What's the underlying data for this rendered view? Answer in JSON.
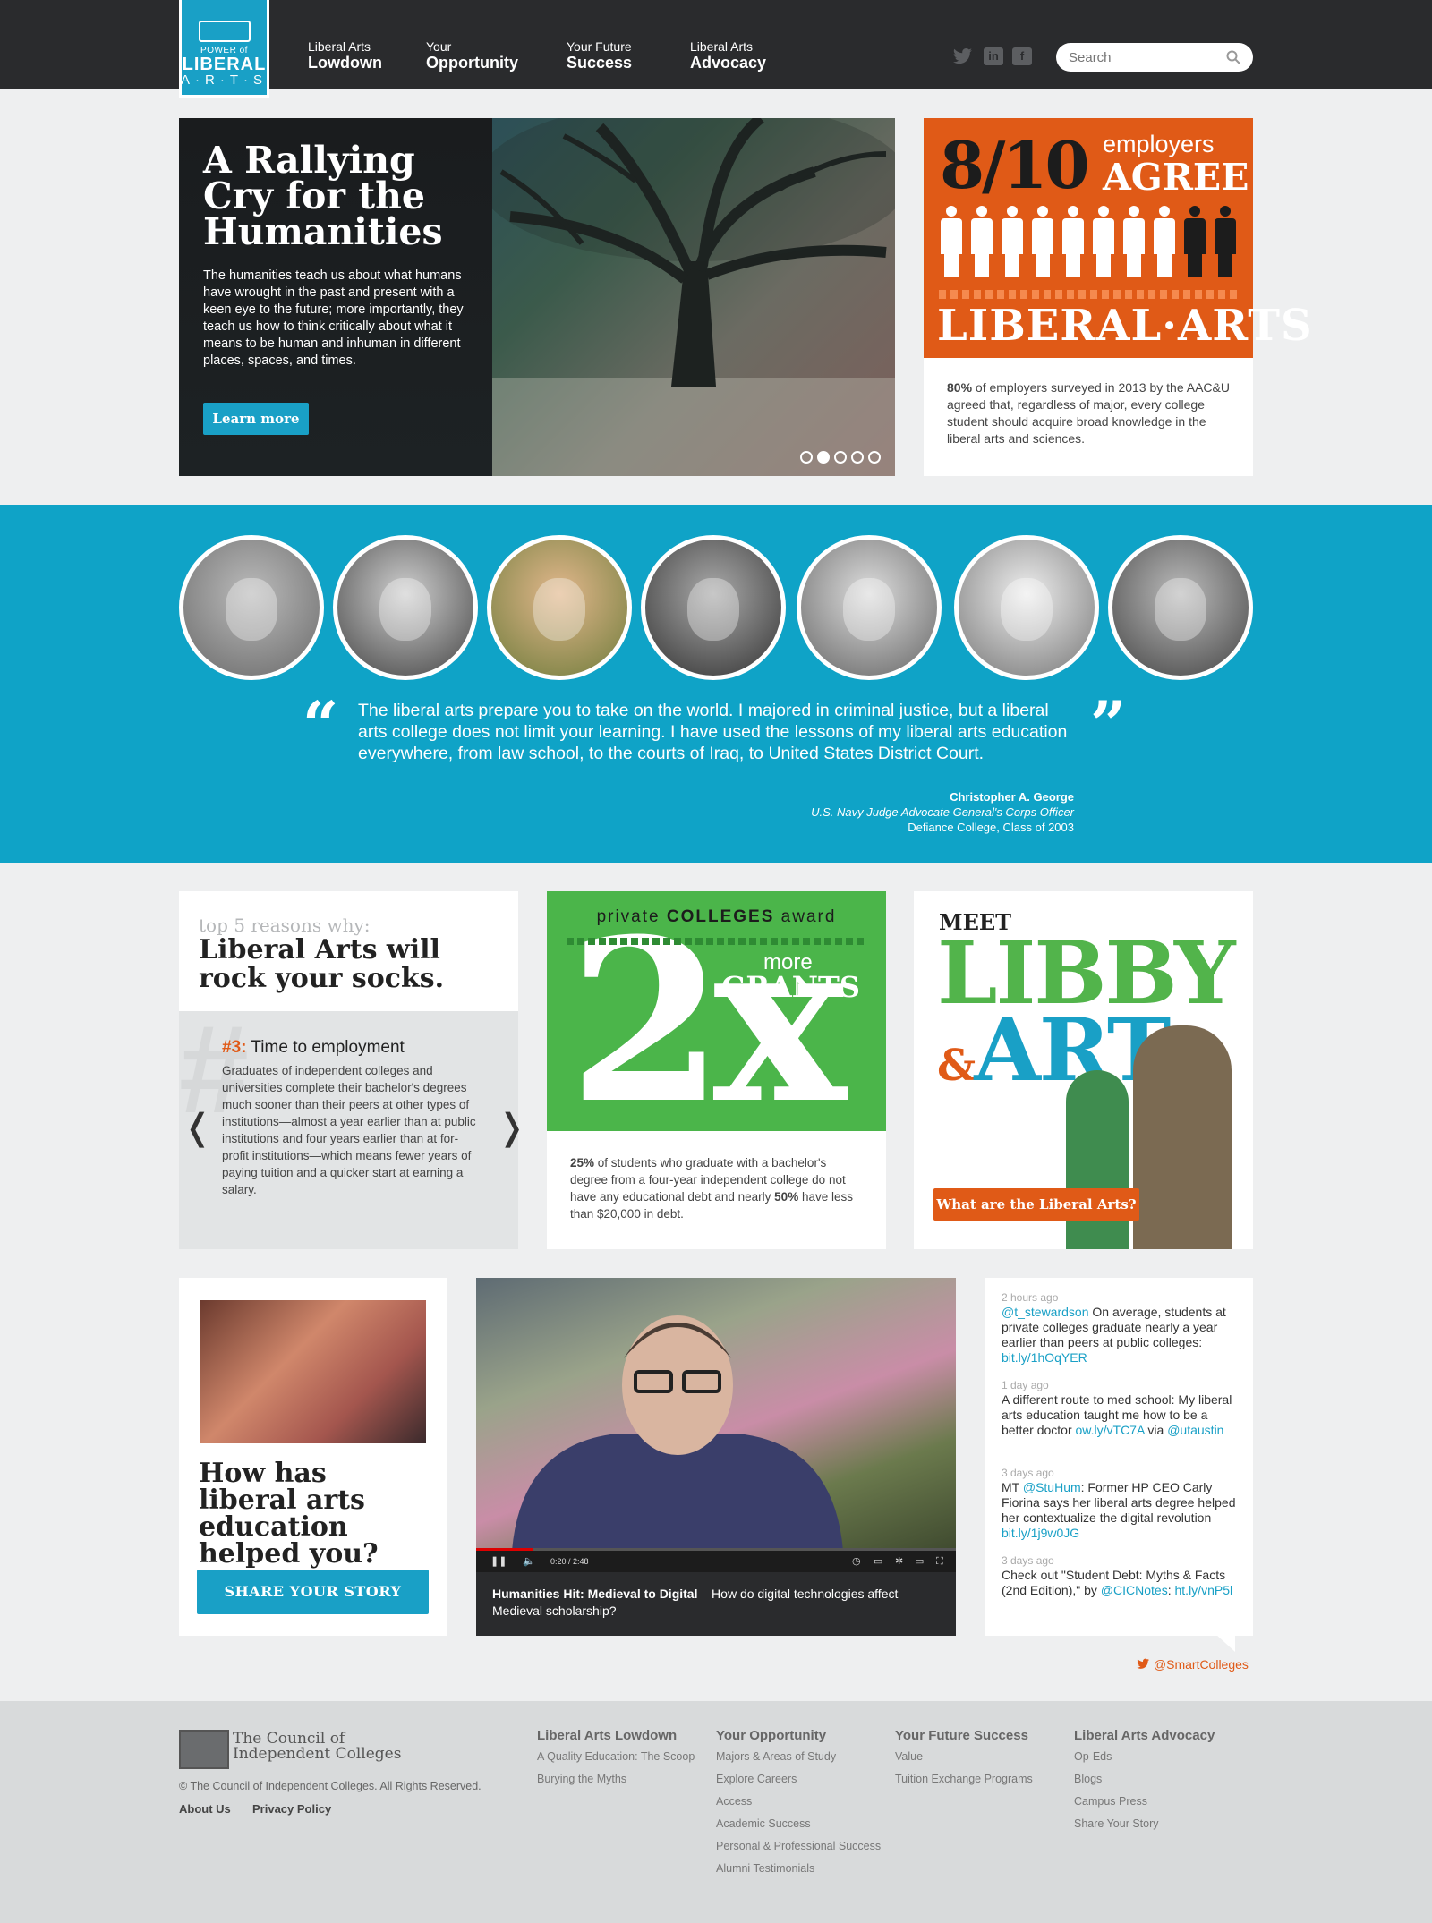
{
  "header": {
    "logo": {
      "line1": "POWER of",
      "line2": "LIBERAL",
      "line3": "A·R·T·S"
    },
    "nav": [
      {
        "small": "Liberal Arts",
        "big": "Lowdown"
      },
      {
        "small": "Your",
        "big": "Opportunity"
      },
      {
        "small": "Your Future",
        "big": "Success"
      },
      {
        "small": "Liberal Arts",
        "big": "Advocacy"
      }
    ],
    "social": [
      "twitter-icon",
      "linkedin-icon",
      "facebook-icon"
    ],
    "search_placeholder": "Search"
  },
  "hero": {
    "title": "A Rallying Cry for the Humanities",
    "body": "The humanities teach us about what humans have wrought in the past and present with a keen eye to the future; more importantly, they teach us how to think critically about what it means to be human and inhuman in different places, spaces, and times.",
    "button": "Learn more",
    "slides_total": 5,
    "slide_active": 2
  },
  "employers": {
    "big": "8/10",
    "small1": "employers",
    "small2": "AGREE",
    "banner": "LIBERAL·ARTS",
    "stat": "80%",
    "text": " of employers surveyed in 2013 by the AAC&U agreed that, regardless of major, every college student should acquire broad knowledge in the liberal arts and sciences."
  },
  "testimonial": {
    "quote": "The liberal arts prepare you to take on the world. I majored in criminal justice, but a liberal arts college does not limit your learning. I have used the lessons of my liberal arts education everywhere, from law school, to the courts of Iraq, to United States District Court.",
    "name": "Christopher A. George",
    "role": "U.S. Navy Judge Advocate General's Corps Officer",
    "school": "Defiance College, Class of 2003",
    "open_mark": "“",
    "close_mark": "”"
  },
  "reasons": {
    "kicker": "top 5 reasons why:",
    "title": "Liberal Arts will rock your socks.",
    "hash": "#",
    "number": "#3:",
    "heading": " Time to employment",
    "body": "Graduates of independent colleges and universities complete their bachelor's degrees much sooner than their peers at other types of institutions—almost a year earlier than at public institutions and four years earlier than at for-profit institutions—which means fewer years of paying tuition and a quicker start at earning a salary.",
    "prev": "❬",
    "next": "❭"
  },
  "grants": {
    "header_pre": "private ",
    "header_bold": "COLLEGES",
    "header_post": " award",
    "big": "2x",
    "more": "more",
    "grants": "GRANTS",
    "stat1": "25%",
    "text1": " of students who graduate with a bachelor's degree from a four-year independent college do not have any educational debt and nearly ",
    "stat2": "50%",
    "text2": " have less than $20,000 in debt."
  },
  "libby": {
    "meet": "MEET",
    "libby": "LIBBY",
    "amp": "&",
    "art": "ART",
    "button": "What are the Liberal Arts?"
  },
  "share": {
    "title": "How has liberal arts education helped you?",
    "button": "SHARE YOUR STORY"
  },
  "video": {
    "time": "0:20 / 2:48",
    "title": "Humanities Hit: Medieval to Digital",
    "desc": " – How do digital technologies affect Medieval scholarship?",
    "progress": 0.12
  },
  "tweets": [
    {
      "ago": "2 hours ago",
      "parts": [
        [
          "@t_stewardson",
          true
        ],
        [
          " On average, students at private colleges graduate nearly a year earlier than peers at public colleges: ",
          false
        ],
        [
          "bit.ly/1hOqYER",
          true
        ]
      ]
    },
    {
      "ago": "1 day ago",
      "parts": [
        [
          "A different route to med school: My liberal arts education taught me how to be a better doctor ",
          false
        ],
        [
          "ow.ly/vTC7A",
          true
        ],
        [
          " via ",
          false
        ],
        [
          "@utaustin",
          true
        ]
      ]
    },
    {
      "ago": "3 days ago",
      "parts": [
        [
          "MT ",
          false
        ],
        [
          "@StuHum",
          true
        ],
        [
          ": Former HP CEO Carly Fiorina says her liberal arts degree helped her contextualize the digital revolution ",
          false
        ],
        [
          "bit.ly/1j9w0JG",
          true
        ]
      ]
    },
    {
      "ago": "3 days ago",
      "parts": [
        [
          "Check out \"Student Debt: Myths & Facts (2nd Edition),\" by ",
          false
        ],
        [
          "@CICNotes",
          true
        ],
        [
          ": ",
          false
        ],
        [
          "ht.ly/vnP5l",
          true
        ]
      ]
    }
  ],
  "twitter_handle": "@SmartColleges",
  "footer": {
    "org_line1": "The Council of",
    "org_line2": "Independent Colleges",
    "copyright": "© The Council of Independent Colleges. All Rights Reserved.",
    "links": [
      "About Us",
      "Privacy Policy"
    ],
    "columns": [
      {
        "title": "Liberal Arts Lowdown",
        "items": [
          "A Quality Education: The Scoop",
          "Burying the Myths"
        ]
      },
      {
        "title": "Your Opportunity",
        "items": [
          "Majors & Areas of Study",
          "Explore Careers",
          "Access",
          "Academic Success",
          "Personal & Professional Success",
          "Alumni Testimonials"
        ]
      },
      {
        "title": "Your Future Success",
        "items": [
          "Value",
          "Tuition Exchange Programs"
        ]
      },
      {
        "title": "Liberal Arts Advocacy",
        "items": [
          "Op-Eds",
          "Blogs",
          "Campus Press",
          "Share Your Story"
        ]
      }
    ]
  },
  "colors": {
    "teal": "#19a0c6",
    "orange": "#e05a17",
    "green": "#4bb54a",
    "dark": "#2a2b2d"
  }
}
